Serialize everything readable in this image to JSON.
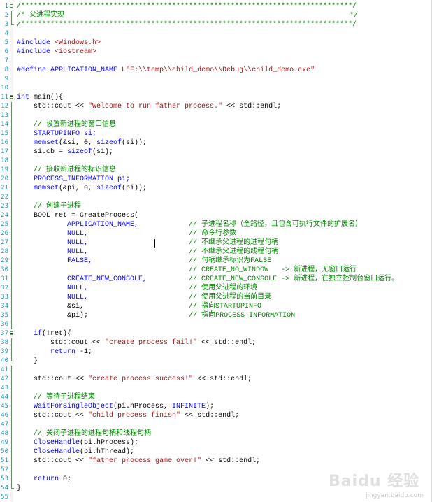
{
  "editor": {
    "lines": [
      {
        "n": "1",
        "fold": "box",
        "segs": [
          {
            "t": "/*******************************************************************************/",
            "c": "cmt"
          }
        ]
      },
      {
        "n": "2",
        "fold": "bar",
        "segs": [
          {
            "t": "/* 父进程实现                                                                    */",
            "c": "cmt"
          }
        ]
      },
      {
        "n": "3",
        "fold": "end",
        "segs": [
          {
            "t": "/*******************************************************************************/",
            "c": "cmt"
          }
        ]
      },
      {
        "n": "4",
        "fold": "",
        "segs": []
      },
      {
        "n": "5",
        "fold": "",
        "segs": [
          {
            "t": "#include ",
            "c": "pp"
          },
          {
            "t": "<Windows.h>",
            "c": "str"
          }
        ]
      },
      {
        "n": "6",
        "fold": "",
        "segs": [
          {
            "t": "#include ",
            "c": "pp"
          },
          {
            "t": "<iostream>",
            "c": "str"
          }
        ]
      },
      {
        "n": "7",
        "fold": "",
        "segs": []
      },
      {
        "n": "8",
        "fold": "",
        "segs": [
          {
            "t": "#define ",
            "c": "pp"
          },
          {
            "t": "APPLICATION_NAME ",
            "c": "pp"
          },
          {
            "t": "L\"F:\\\\temp\\\\child_demo\\\\Debug\\\\child_demo.exe\"",
            "c": "str"
          }
        ]
      },
      {
        "n": "9",
        "fold": "",
        "segs": []
      },
      {
        "n": "10",
        "fold": "",
        "segs": []
      },
      {
        "n": "11",
        "fold": "box",
        "segs": [
          {
            "t": "int",
            "c": "kw"
          },
          {
            "t": " main(){",
            "c": ""
          }
        ]
      },
      {
        "n": "12",
        "fold": "bar",
        "segs": [
          {
            "t": "    std::cout << ",
            "c": ""
          },
          {
            "t": "\"Welcome to run father process.\"",
            "c": "str"
          },
          {
            "t": " << std::endl;",
            "c": ""
          }
        ]
      },
      {
        "n": "13",
        "fold": "bar",
        "segs": []
      },
      {
        "n": "14",
        "fold": "bar",
        "segs": [
          {
            "t": "    // 设置新进程的窗口信息",
            "c": "cmt"
          }
        ]
      },
      {
        "n": "15",
        "fold": "bar",
        "segs": [
          {
            "t": "    STARTUPINFO si;",
            "c": "pp"
          }
        ]
      },
      {
        "n": "16",
        "fold": "bar",
        "segs": [
          {
            "t": "    memset",
            "c": "pp"
          },
          {
            "t": "(&si, 0, ",
            "c": ""
          },
          {
            "t": "sizeof",
            "c": "kw"
          },
          {
            "t": "(si));",
            "c": ""
          }
        ]
      },
      {
        "n": "17",
        "fold": "bar",
        "segs": [
          {
            "t": "    si.cb = ",
            "c": ""
          },
          {
            "t": "sizeof",
            "c": "kw"
          },
          {
            "t": "(si);",
            "c": ""
          }
        ]
      },
      {
        "n": "18",
        "fold": "bar",
        "segs": []
      },
      {
        "n": "19",
        "fold": "bar",
        "segs": [
          {
            "t": "    // 接收新进程的标识信息",
            "c": "cmt"
          }
        ]
      },
      {
        "n": "20",
        "fold": "bar",
        "segs": [
          {
            "t": "    PROCESS_INFORMATION pi;",
            "c": "pp"
          }
        ]
      },
      {
        "n": "21",
        "fold": "bar",
        "segs": [
          {
            "t": "    memset",
            "c": "pp"
          },
          {
            "t": "(&pi, 0, ",
            "c": ""
          },
          {
            "t": "sizeof",
            "c": "kw"
          },
          {
            "t": "(pi));",
            "c": ""
          }
        ]
      },
      {
        "n": "22",
        "fold": "bar",
        "segs": []
      },
      {
        "n": "23",
        "fold": "bar",
        "segs": [
          {
            "t": "    // 创建子进程",
            "c": "cmt"
          }
        ]
      },
      {
        "n": "24",
        "fold": "bar",
        "segs": [
          {
            "t": "    BOOL ret = CreateProcess(",
            "c": ""
          }
        ]
      },
      {
        "n": "25",
        "fold": "bar",
        "segs": [
          {
            "t": "            APPLICATION_NAME,",
            "c": "pp"
          },
          {
            "t": "            ",
            "c": ""
          },
          {
            "t": "// 子进程名称（全路径，且包含可执行文件的扩展名）",
            "c": "cmt"
          }
        ]
      },
      {
        "n": "26",
        "fold": "bar",
        "segs": [
          {
            "t": "            NULL,",
            "c": "pp"
          },
          {
            "t": "                        ",
            "c": ""
          },
          {
            "t": "// 命令行参数",
            "c": "cmt"
          }
        ]
      },
      {
        "n": "27",
        "fold": "bar",
        "segs": [
          {
            "t": "            NULL,",
            "c": "pp"
          },
          {
            "t": "                        ",
            "c": ""
          },
          {
            "t": "// 不继承父进程的进程句柄",
            "c": "cmt"
          }
        ]
      },
      {
        "n": "28",
        "fold": "bar",
        "segs": [
          {
            "t": "            NULL,",
            "c": "pp"
          },
          {
            "t": "                        ",
            "c": ""
          },
          {
            "t": "// 不继承父进程的线程句柄",
            "c": "cmt"
          }
        ]
      },
      {
        "n": "29",
        "fold": "bar",
        "segs": [
          {
            "t": "            FALSE,",
            "c": "pp"
          },
          {
            "t": "                       ",
            "c": ""
          },
          {
            "t": "// 句柄继承标识为FALSE",
            "c": "cmt"
          }
        ]
      },
      {
        "n": "30",
        "fold": "bar",
        "segs": [
          {
            "t": "                                         ",
            "c": ""
          },
          {
            "t": "// CREATE_NO_WINDOW   -> 新进程，无窗口运行",
            "c": "cmt"
          }
        ]
      },
      {
        "n": "31",
        "fold": "bar",
        "segs": [
          {
            "t": "            CREATE_NEW_CONSOLE,",
            "c": "pp"
          },
          {
            "t": "          ",
            "c": ""
          },
          {
            "t": "// CREATE_NEW_CONSOLE -> 新进程，在独立控制台窗口运行。",
            "c": "cmt"
          }
        ]
      },
      {
        "n": "32",
        "fold": "bar",
        "segs": [
          {
            "t": "            NULL,",
            "c": "pp"
          },
          {
            "t": "                        ",
            "c": ""
          },
          {
            "t": "// 使用父进程的环境",
            "c": "cmt"
          }
        ]
      },
      {
        "n": "33",
        "fold": "bar",
        "segs": [
          {
            "t": "            NULL,",
            "c": "pp"
          },
          {
            "t": "                        ",
            "c": ""
          },
          {
            "t": "// 使用父进程的当前目录",
            "c": "cmt"
          }
        ]
      },
      {
        "n": "34",
        "fold": "bar",
        "segs": [
          {
            "t": "            &si,",
            "c": ""
          },
          {
            "t": "                         ",
            "c": ""
          },
          {
            "t": "// 指向STARTUPINFO",
            "c": "cmt"
          }
        ]
      },
      {
        "n": "35",
        "fold": "bar",
        "segs": [
          {
            "t": "            &pi);",
            "c": ""
          },
          {
            "t": "                        ",
            "c": ""
          },
          {
            "t": "// 指向PROCESS_INFORMATION",
            "c": "cmt"
          }
        ]
      },
      {
        "n": "36",
        "fold": "bar",
        "segs": []
      },
      {
        "n": "37",
        "fold": "box",
        "segs": [
          {
            "t": "    if",
            "c": "kw"
          },
          {
            "t": "(!ret){",
            "c": ""
          }
        ]
      },
      {
        "n": "38",
        "fold": "bar",
        "segs": [
          {
            "t": "        std::cout << ",
            "c": ""
          },
          {
            "t": "\"create process fail!\"",
            "c": "str"
          },
          {
            "t": " << std::endl;",
            "c": ""
          }
        ]
      },
      {
        "n": "39",
        "fold": "bar",
        "segs": [
          {
            "t": "        return",
            "c": "kw"
          },
          {
            "t": " -1;",
            "c": ""
          }
        ]
      },
      {
        "n": "40",
        "fold": "end",
        "segs": [
          {
            "t": "    }",
            "c": ""
          }
        ]
      },
      {
        "n": "41",
        "fold": "bar",
        "segs": []
      },
      {
        "n": "42",
        "fold": "bar",
        "segs": [
          {
            "t": "    std::cout << ",
            "c": ""
          },
          {
            "t": "\"create process success!\"",
            "c": "str"
          },
          {
            "t": " << std::endl;",
            "c": ""
          }
        ]
      },
      {
        "n": "43",
        "fold": "bar",
        "segs": []
      },
      {
        "n": "44",
        "fold": "bar",
        "segs": [
          {
            "t": "    // 等待子进程结束",
            "c": "cmt"
          }
        ]
      },
      {
        "n": "45",
        "fold": "bar",
        "segs": [
          {
            "t": "    WaitForSingleObject",
            "c": "pp"
          },
          {
            "t": "(pi.hProcess, ",
            "c": ""
          },
          {
            "t": "INFINITE",
            "c": "pp"
          },
          {
            "t": ");",
            "c": ""
          }
        ]
      },
      {
        "n": "46",
        "fold": "bar",
        "segs": [
          {
            "t": "    std::cout << ",
            "c": ""
          },
          {
            "t": "\"child process finish\"",
            "c": "str"
          },
          {
            "t": " << std::endl;",
            "c": ""
          }
        ]
      },
      {
        "n": "47",
        "fold": "bar",
        "segs": []
      },
      {
        "n": "48",
        "fold": "bar",
        "segs": [
          {
            "t": "    // 关闭子进程的进程句柄和线程句柄",
            "c": "cmt"
          }
        ]
      },
      {
        "n": "49",
        "fold": "bar",
        "segs": [
          {
            "t": "    CloseHandle",
            "c": "pp"
          },
          {
            "t": "(pi.hProcess);",
            "c": ""
          }
        ]
      },
      {
        "n": "50",
        "fold": "bar",
        "segs": [
          {
            "t": "    CloseHandle",
            "c": "pp"
          },
          {
            "t": "(pi.hThread);",
            "c": ""
          }
        ]
      },
      {
        "n": "51",
        "fold": "bar",
        "segs": [
          {
            "t": "    std::cout << ",
            "c": ""
          },
          {
            "t": "\"father process game over!\"",
            "c": "str"
          },
          {
            "t": " << std::endl;",
            "c": ""
          }
        ]
      },
      {
        "n": "52",
        "fold": "bar",
        "segs": []
      },
      {
        "n": "53",
        "fold": "bar",
        "segs": [
          {
            "t": "    return",
            "c": "kw"
          },
          {
            "t": " 0;",
            "c": ""
          }
        ]
      },
      {
        "n": "54",
        "fold": "end",
        "segs": [
          {
            "t": "}",
            "c": ""
          }
        ]
      },
      {
        "n": "55",
        "fold": "",
        "segs": []
      }
    ]
  },
  "watermark": {
    "logo": "Baidu 经验",
    "url": "jingyan.baidu.com"
  },
  "colors": {
    "comment": "#008000",
    "keyword": "#0000ff",
    "string": "#a31515",
    "line_number": "#2b91af"
  }
}
